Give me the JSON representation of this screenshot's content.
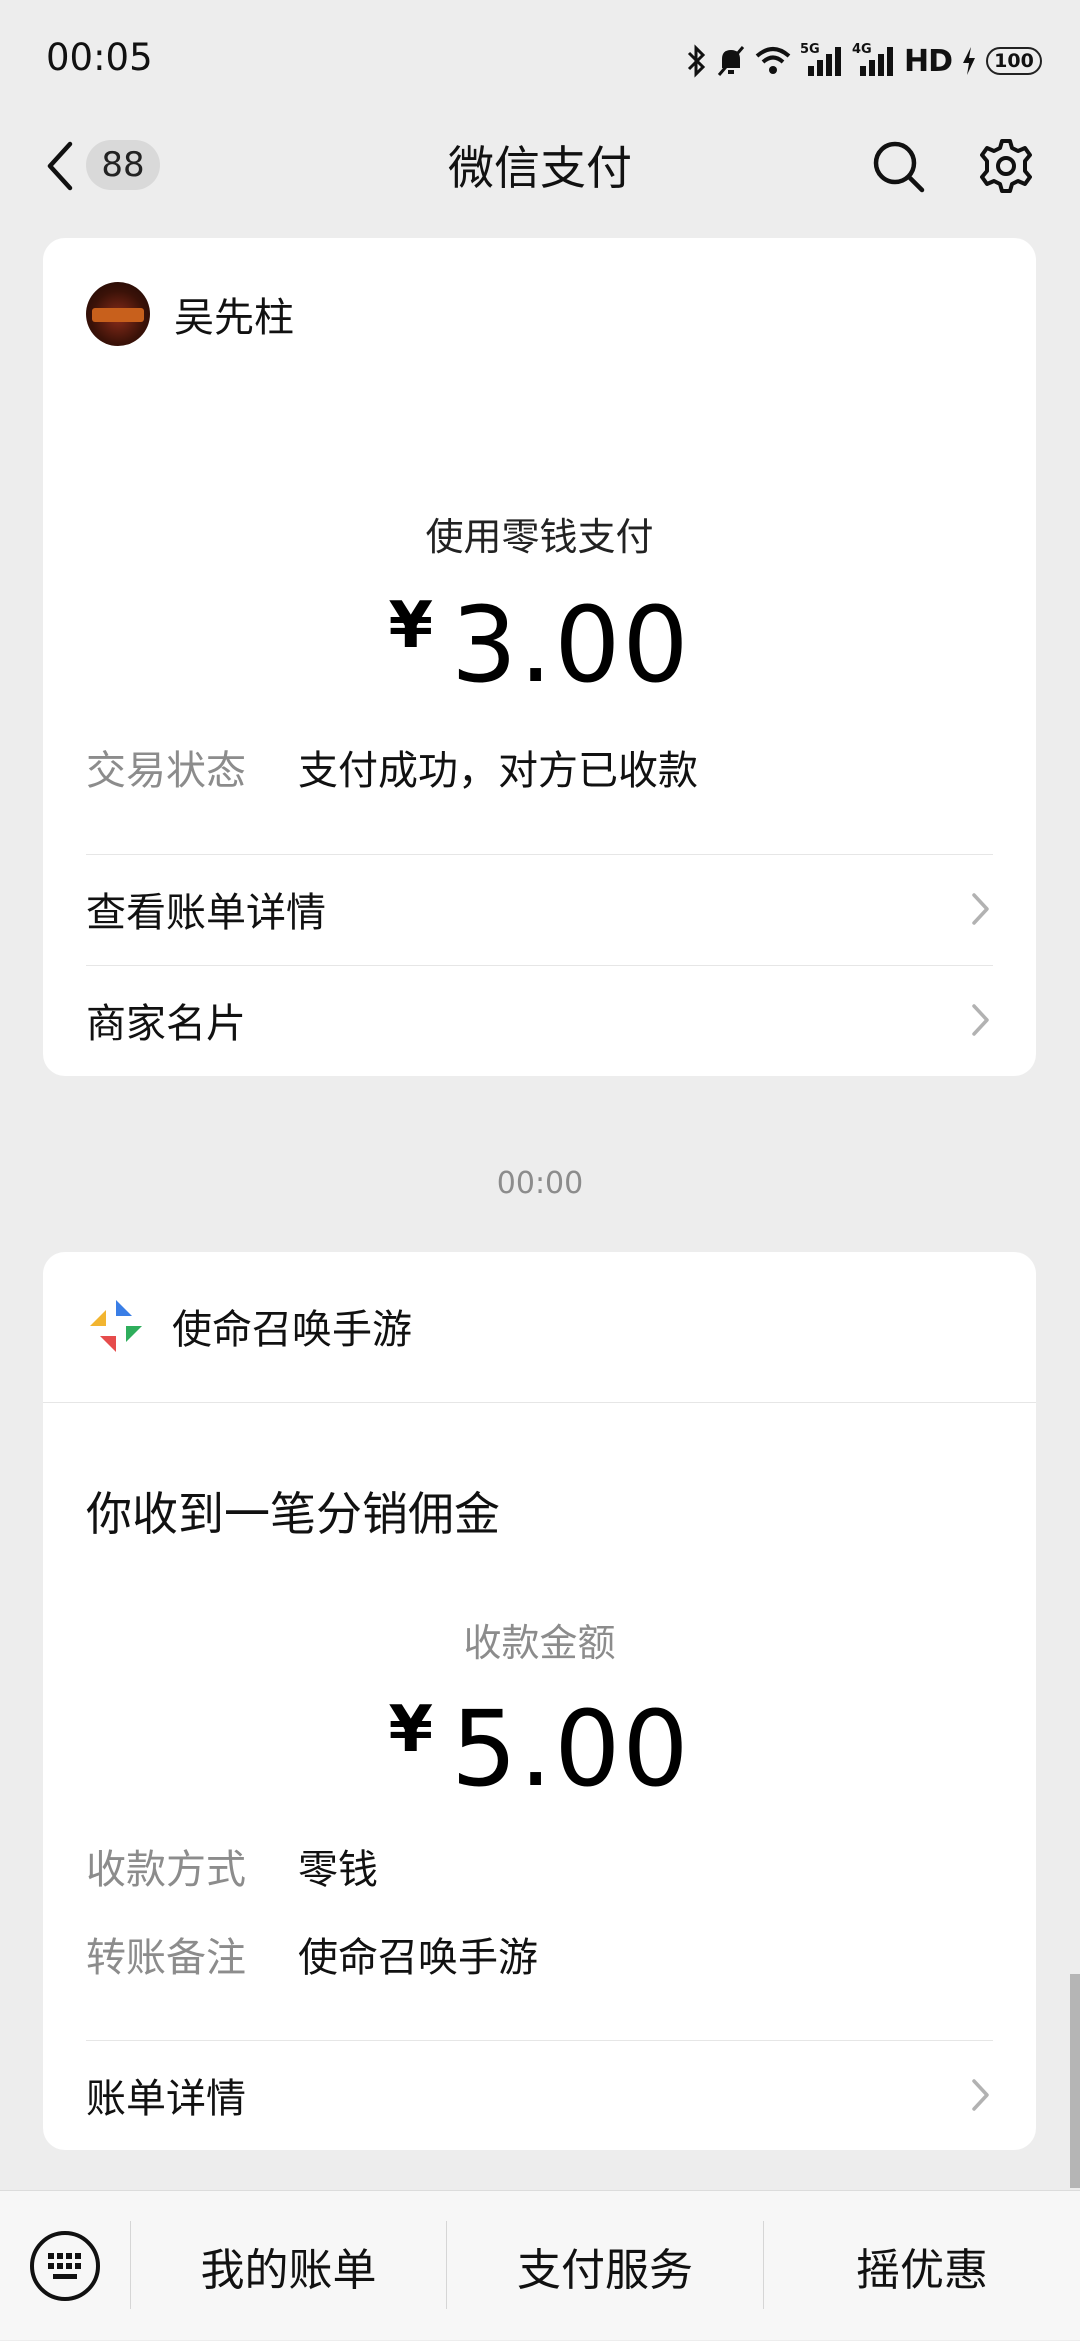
{
  "status_bar": {
    "time": "00:05",
    "network_5g": "5G",
    "network_4g": "4G",
    "hd": "HD",
    "battery": "100"
  },
  "nav": {
    "unread_count": "88",
    "title": "微信支付"
  },
  "payment_card": {
    "payee_name": "吴先柱",
    "pay_method": "使用零钱支付",
    "currency": "¥",
    "amount": "3.00",
    "status_label": "交易状态",
    "status_value": "支付成功，对方已收款",
    "links": [
      {
        "label": "查看账单详情"
      },
      {
        "label": "商家名片"
      }
    ]
  },
  "timestamp": "00:00",
  "commission_card": {
    "merchant_name": "使命召唤手游",
    "notice": "你收到一笔分销佣金",
    "amount_label": "收款金额",
    "currency": "¥",
    "amount": "5.00",
    "details": [
      {
        "label": "收款方式",
        "value": "零钱"
      },
      {
        "label": "转账备注",
        "value": "使命召唤手游"
      }
    ],
    "link_label": "账单详情"
  },
  "bottom_bar": {
    "items": [
      {
        "label": "我的账单"
      },
      {
        "label": "支付服务"
      },
      {
        "label": "摇优惠"
      }
    ]
  },
  "colors": {
    "background": "#ededed",
    "card": "#ffffff",
    "secondary_text": "#8c8c8c"
  }
}
